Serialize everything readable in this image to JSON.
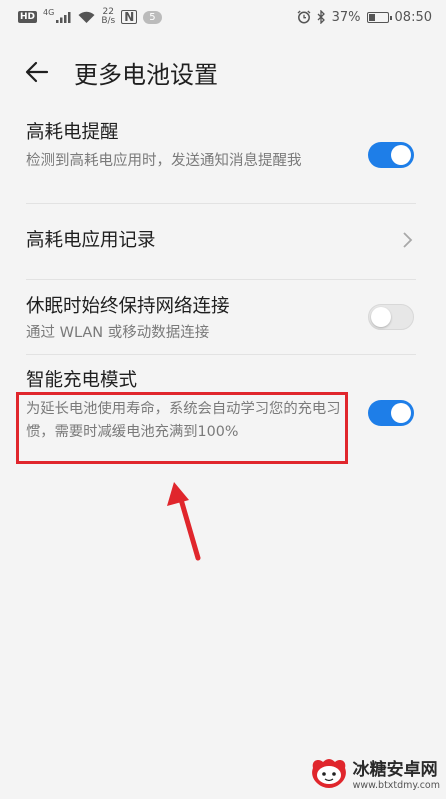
{
  "status_bar": {
    "hd": "HD",
    "network": "4G",
    "speed_value": "22",
    "speed_unit": "B/s",
    "nfc": "N",
    "notification_count": "5",
    "battery_percent": "37%",
    "battery_level": 0.37,
    "time": "08:50"
  },
  "header": {
    "title": "更多电池设置"
  },
  "settings": {
    "high_power_alert": {
      "title": "高耗电提醒",
      "desc": "检测到高耗电应用时，发送通知消息提醒我",
      "enabled": true
    },
    "high_power_record": {
      "title": "高耗电应用记录"
    },
    "keep_network": {
      "title": "休眠时始终保持网络连接",
      "desc": "通过 WLAN 或移动数据连接",
      "enabled": false
    },
    "smart_charge": {
      "title": "智能充电模式",
      "desc": "为延长电池使用寿命，系统会自动学习您的充电习惯，需要时减缓电池充满到100%",
      "enabled": true
    }
  },
  "watermark": {
    "name": "冰糖安卓网",
    "url": "www.btxtdmy.com"
  },
  "colors": {
    "accent": "#1e7ee8",
    "annotation": "#e0262c"
  }
}
